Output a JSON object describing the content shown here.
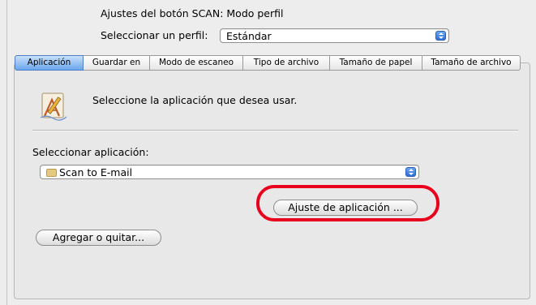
{
  "window": {
    "title": "Ajustes del botón SCAN: Modo perfil"
  },
  "profile": {
    "label": "Seleccionar un perfil:",
    "selected": "Estándar"
  },
  "tabs": [
    {
      "label": "Aplicación",
      "active": true
    },
    {
      "label": "Guardar en",
      "active": false
    },
    {
      "label": "Modo de escaneo",
      "active": false
    },
    {
      "label": "Tipo de archivo",
      "active": false
    },
    {
      "label": "Tamaño de papel",
      "active": false
    },
    {
      "label": "Tamaño de archivo",
      "active": false
    }
  ],
  "panel": {
    "prompt": "Seleccione la aplicación que desea usar.",
    "app_label": "Seleccionar aplicación:",
    "app_selected": "Scan to E-mail",
    "app_settings_button": "Ajuste de aplicación ...",
    "add_remove_button": "Agregar o quitar..."
  },
  "icons": {
    "application": "pencil-ruler-application-icon",
    "folder": "folder-icon",
    "stepper": "popup-stepper-icon"
  },
  "colors": {
    "accent": "#3d7fe0",
    "highlight_ring": "#e8001c",
    "window_bg": "#ededed"
  }
}
